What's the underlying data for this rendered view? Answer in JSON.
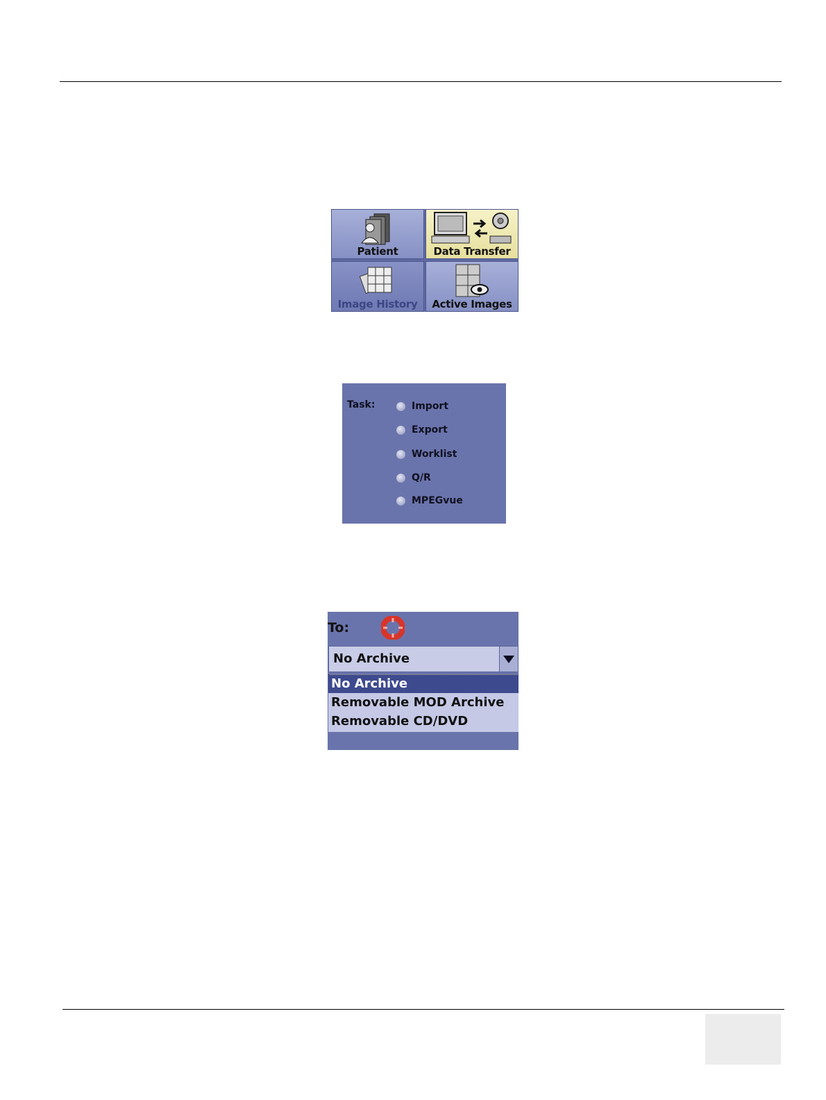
{
  "tabs": [
    {
      "label": "Patient",
      "icon": "patient-folder-icon"
    },
    {
      "label": "Data Transfer",
      "icon": "data-transfer-icon",
      "selected": true
    },
    {
      "label": "Image History",
      "icon": "image-history-icon"
    },
    {
      "label": "Active Images",
      "icon": "active-images-icon"
    }
  ],
  "task": {
    "label": "Task:",
    "options": [
      "Import",
      "Export",
      "Worklist",
      "Q/R",
      "MPEGvue"
    ]
  },
  "archive": {
    "to_label": "To:",
    "selected_value": "No Archive",
    "options": [
      "No Archive",
      "Removable MOD Archive",
      "Removable CD/DVD"
    ],
    "highlighted_index": 0
  }
}
